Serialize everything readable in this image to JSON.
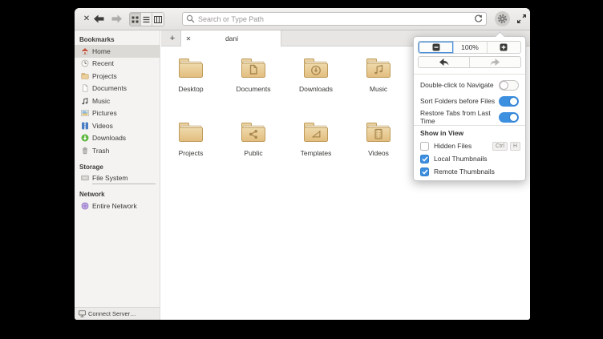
{
  "icons": {
    "window_close": "✕",
    "new_tab": "+",
    "tab_close": "✕"
  },
  "toolbar": {
    "search_placeholder": "Search or Type Path"
  },
  "tab": {
    "label": "dani"
  },
  "sidebar": {
    "sections": [
      {
        "header": "Bookmarks",
        "items": [
          {
            "label": "Home",
            "icon": "home-icon",
            "selected": true
          },
          {
            "label": "Recent",
            "icon": "clock-icon"
          },
          {
            "label": "Projects",
            "icon": "folder-icon"
          },
          {
            "label": "Documents",
            "icon": "document-icon"
          },
          {
            "label": "Music",
            "icon": "music-note-icon"
          },
          {
            "label": "Pictures",
            "icon": "photo-icon"
          },
          {
            "label": "Videos",
            "icon": "film-icon"
          },
          {
            "label": "Downloads",
            "icon": "download-circle-icon"
          },
          {
            "label": "Trash",
            "icon": "trash-icon"
          }
        ]
      },
      {
        "header": "Storage",
        "items": [
          {
            "label": "File System",
            "icon": "harddisk-icon"
          }
        ]
      },
      {
        "header": "Network",
        "items": [
          {
            "label": "Entire Network",
            "icon": "network-globe-icon"
          }
        ]
      }
    ],
    "connect_server": "Connect Server…"
  },
  "folders": [
    {
      "name": "Desktop",
      "glyph": "none"
    },
    {
      "name": "Documents",
      "glyph": "page"
    },
    {
      "name": "Downloads",
      "glyph": "down-arrow-circle"
    },
    {
      "name": "Music",
      "glyph": "music-note"
    },
    {
      "name": "Projects",
      "glyph": "none"
    },
    {
      "name": "Public",
      "glyph": "share"
    },
    {
      "name": "Templates",
      "glyph": "triangle"
    },
    {
      "name": "Videos",
      "glyph": "film-strip"
    }
  ],
  "menu": {
    "zoom_level": "100%",
    "toggles": [
      {
        "label": "Double-click to Navigate",
        "state": "off"
      },
      {
        "label": "Sort Folders before Files",
        "state": "on"
      },
      {
        "label": "Restore Tabs from Last Time",
        "state": "on"
      }
    ],
    "show_in_view": "Show in View",
    "checks": [
      {
        "label": "Hidden Files",
        "checked": false,
        "shortcut_keys": [
          "Ctrl",
          "H"
        ]
      },
      {
        "label": "Local Thumbnails",
        "checked": true
      },
      {
        "label": "Remote Thumbnails",
        "checked": true
      }
    ]
  },
  "colors": {
    "accent_blue": "#3d8fe0",
    "folder_tan": "#e7c588",
    "folder_border": "#bd9a58",
    "selection_gray": "#dcdad7",
    "background": "#000000"
  }
}
